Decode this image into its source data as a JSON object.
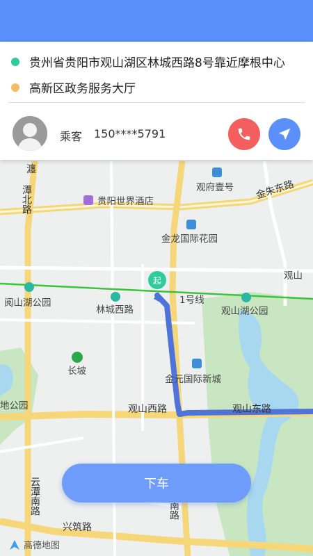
{
  "trip": {
    "origin": "贵州省贵阳市观山湖区林城西路8号靠近摩根中心",
    "destination": "高新区政务服务大厅",
    "origin_color": "#2ecc9a",
    "destination_color": "#f7b965"
  },
  "passenger": {
    "label": "乘客",
    "phone": "150****5791"
  },
  "actions": {
    "alight_label": "下车",
    "call_icon": "phone-icon",
    "navigate_icon": "navigation-arrow-icon"
  },
  "map": {
    "labels": {
      "hotel": "贵阳世界酒店",
      "guanshan_no1": "观府壹号",
      "jinzhu_east": "金朱东路",
      "jinlong": "金龙国际花园",
      "guanshan_side": "观山",
      "metro_line": "1号线",
      "yueshanhu_park": "阅山湖公园",
      "linchengxi_station": "林城西路",
      "guanshanhu_park": "观山湖公园",
      "changpo": "长坡",
      "jinyuan": "金元国际新城",
      "park_partial": "地公园",
      "guanshan_west": "观山西路",
      "guanshan_east": "观山东路",
      "xingzhu": "兴筑路",
      "yuntan_north": "潭北路",
      "yuntan_north_top": "瀍",
      "yuntan_south": "云潭南路",
      "south_road": "南路",
      "start_marker": "起"
    },
    "watermark": "高德地图",
    "route_color": "#4f74d9",
    "metro_color": "#3cc33c",
    "water_color": "#a8d8f0",
    "green_color": "#c9e6c2"
  }
}
